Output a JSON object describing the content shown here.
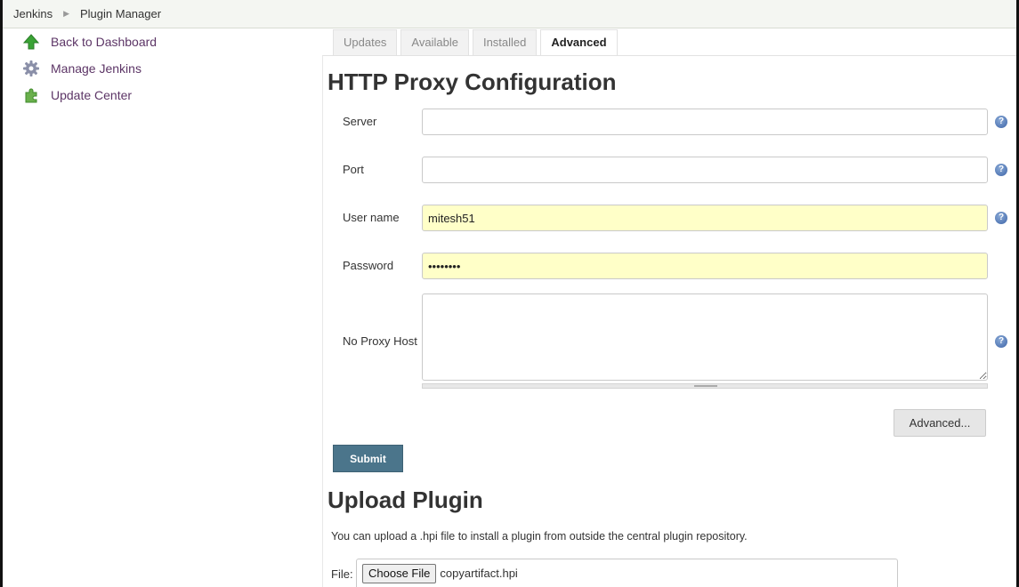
{
  "breadcrumb": {
    "root": "Jenkins",
    "current": "Plugin Manager",
    "separator_icon": "chevron-right"
  },
  "sidebar": {
    "items": [
      {
        "label": "Back to Dashboard",
        "icon": "up-arrow-icon"
      },
      {
        "label": "Manage Jenkins",
        "icon": "gear-icon"
      },
      {
        "label": "Update Center",
        "icon": "puzzle-icon"
      }
    ]
  },
  "tabs": [
    {
      "label": "Updates",
      "active": false
    },
    {
      "label": "Available",
      "active": false
    },
    {
      "label": "Installed",
      "active": false
    },
    {
      "label": "Advanced",
      "active": true
    }
  ],
  "proxy": {
    "title": "HTTP Proxy Configuration",
    "server_label": "Server",
    "server_value": "",
    "port_label": "Port",
    "port_value": "",
    "username_label": "User name",
    "username_value": "mitesh51",
    "password_label": "Password",
    "password_value": "••••••••",
    "noproxy_label": "No Proxy Host",
    "noproxy_value": "",
    "advanced_button": "Advanced...",
    "submit_button": "Submit"
  },
  "upload": {
    "title": "Upload Plugin",
    "description": "You can upload a .hpi file to install a plugin from outside the central plugin repository.",
    "file_label": "File:",
    "choose_button": "Choose File",
    "file_name": "copyartifact.hpi"
  },
  "colors": {
    "link": "#5c3566",
    "submit_bg": "#4b758b",
    "autofill_bg": "#ffffc8",
    "help_icon": "#3d64a8"
  }
}
